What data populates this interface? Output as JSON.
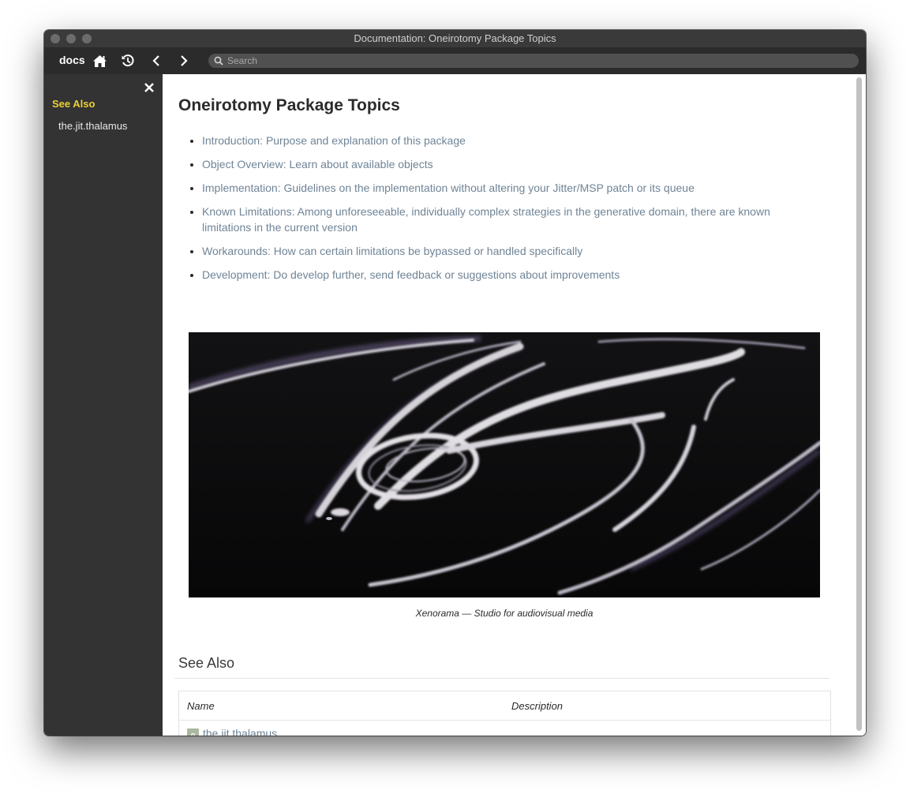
{
  "window": {
    "title": "Documentation: Oneirotomy Package Topics"
  },
  "toolbar": {
    "docs_label": "docs",
    "search_placeholder": "Search"
  },
  "sidebar": {
    "heading": "See Also",
    "items": [
      "the.jit.thalamus"
    ]
  },
  "content": {
    "title": "Oneirotomy Package Topics",
    "topics": [
      "Introduction: Purpose and explanation of this package",
      "Object Overview: Learn about available objects",
      "Implementation: Guidelines on the implementation without altering your Jitter/MSP patch or its queue",
      "Known Limitations: Among unforeseeable, individually complex strategies in the generative domain, there are known limitations in the current version",
      "Workarounds: How can certain limitations be bypassed or handled specifically",
      "Development: Do develop further, send feedback or suggestions about improvements"
    ],
    "image_caption": "Xenorama — Studio for audiovisual media",
    "see_also": {
      "heading": "See Also",
      "columns": [
        "Name",
        "Description"
      ],
      "rows": [
        {
          "icon_letter": "o",
          "name": "the.jit.thalamus",
          "description": ""
        }
      ]
    }
  },
  "colors": {
    "accent_yellow": "#ebd035",
    "link": "#6f8496",
    "sidebar_bg": "#333333",
    "toolbar_bg": "#2b2b2b"
  },
  "icons": {
    "home": "home-icon",
    "history": "history-icon",
    "back": "chevron-left-icon",
    "forward": "chevron-right-icon",
    "search": "search-icon",
    "close": "close-icon",
    "object": "object-icon"
  }
}
